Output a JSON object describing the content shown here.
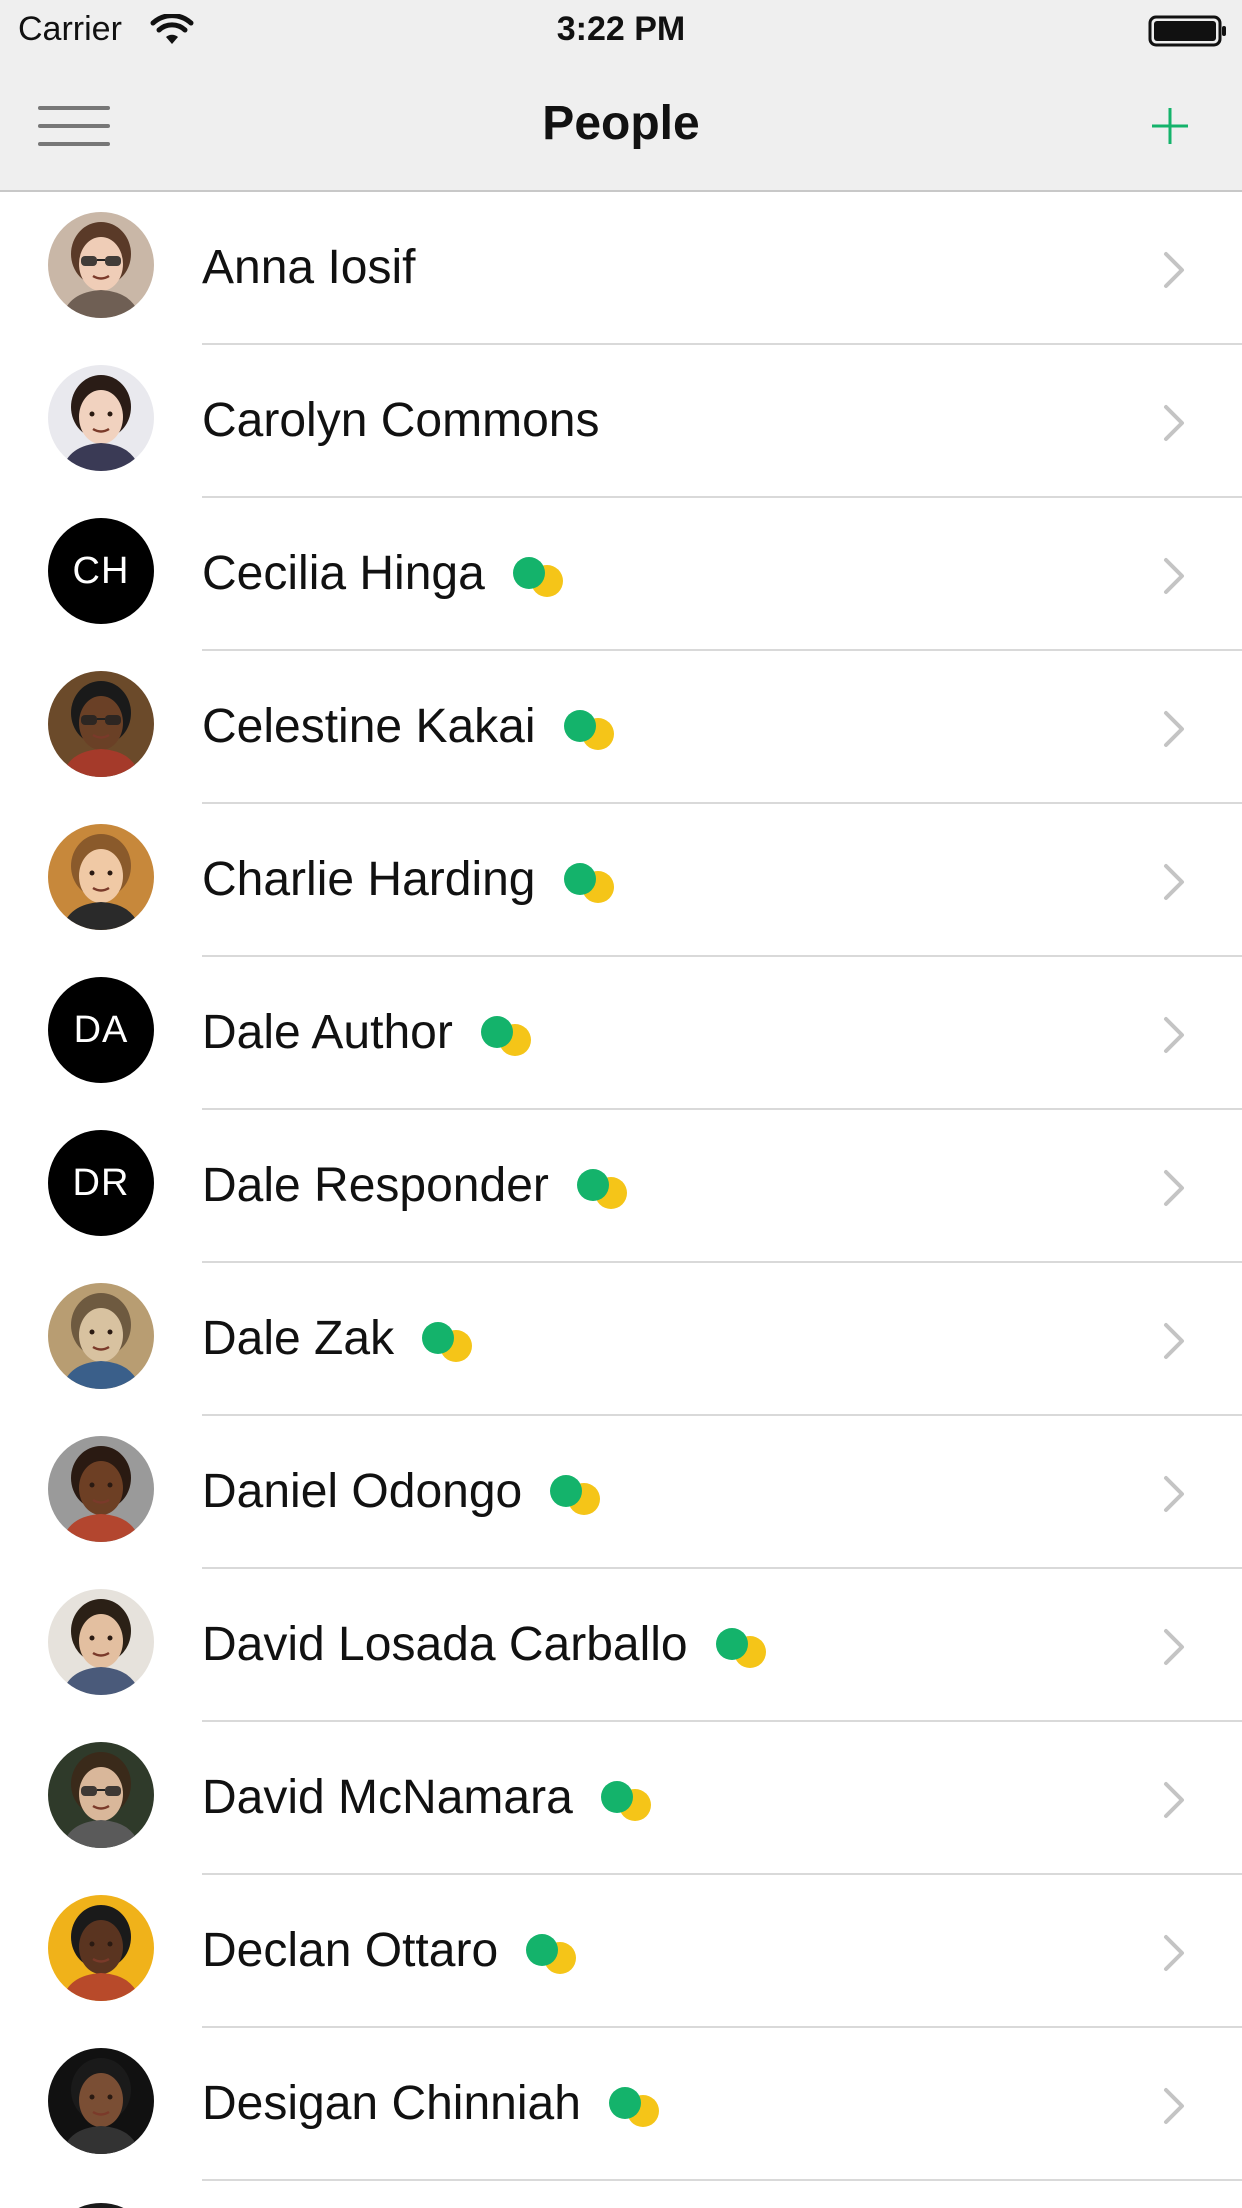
{
  "status_bar": {
    "carrier": "Carrier",
    "time": "3:22 PM"
  },
  "nav": {
    "title": "People",
    "menu_icon": "hamburger-menu-icon",
    "add_icon": "plus-icon"
  },
  "colors": {
    "accent": "#14b36b",
    "presence_green": "#14b36b",
    "presence_yellow": "#f5c518",
    "nav_background": "#efefef",
    "separator": "#d9d9d9",
    "chevron": "#c4c4c4"
  },
  "people": [
    {
      "name": "Anna Iosif",
      "avatar": "photo",
      "initials": "",
      "presence": false
    },
    {
      "name": "Carolyn Commons",
      "avatar": "photo",
      "initials": "",
      "presence": false
    },
    {
      "name": "Cecilia Hinga",
      "avatar": "initials",
      "initials": "CH",
      "presence": true
    },
    {
      "name": "Celestine Kakai",
      "avatar": "photo",
      "initials": "",
      "presence": true
    },
    {
      "name": "Charlie Harding",
      "avatar": "photo",
      "initials": "",
      "presence": true
    },
    {
      "name": "Dale Author",
      "avatar": "initials",
      "initials": "DA",
      "presence": true
    },
    {
      "name": "Dale Responder",
      "avatar": "initials",
      "initials": "DR",
      "presence": true
    },
    {
      "name": "Dale Zak",
      "avatar": "photo",
      "initials": "",
      "presence": true
    },
    {
      "name": "Daniel Odongo",
      "avatar": "photo",
      "initials": "",
      "presence": true
    },
    {
      "name": "David Losada Carballo",
      "avatar": "photo",
      "initials": "",
      "presence": true
    },
    {
      "name": "David McNamara",
      "avatar": "photo",
      "initials": "",
      "presence": true
    },
    {
      "name": "Declan Ottaro",
      "avatar": "photo",
      "initials": "",
      "presence": true
    },
    {
      "name": "Desigan Chinniah",
      "avatar": "photo",
      "initials": "",
      "presence": true
    }
  ]
}
